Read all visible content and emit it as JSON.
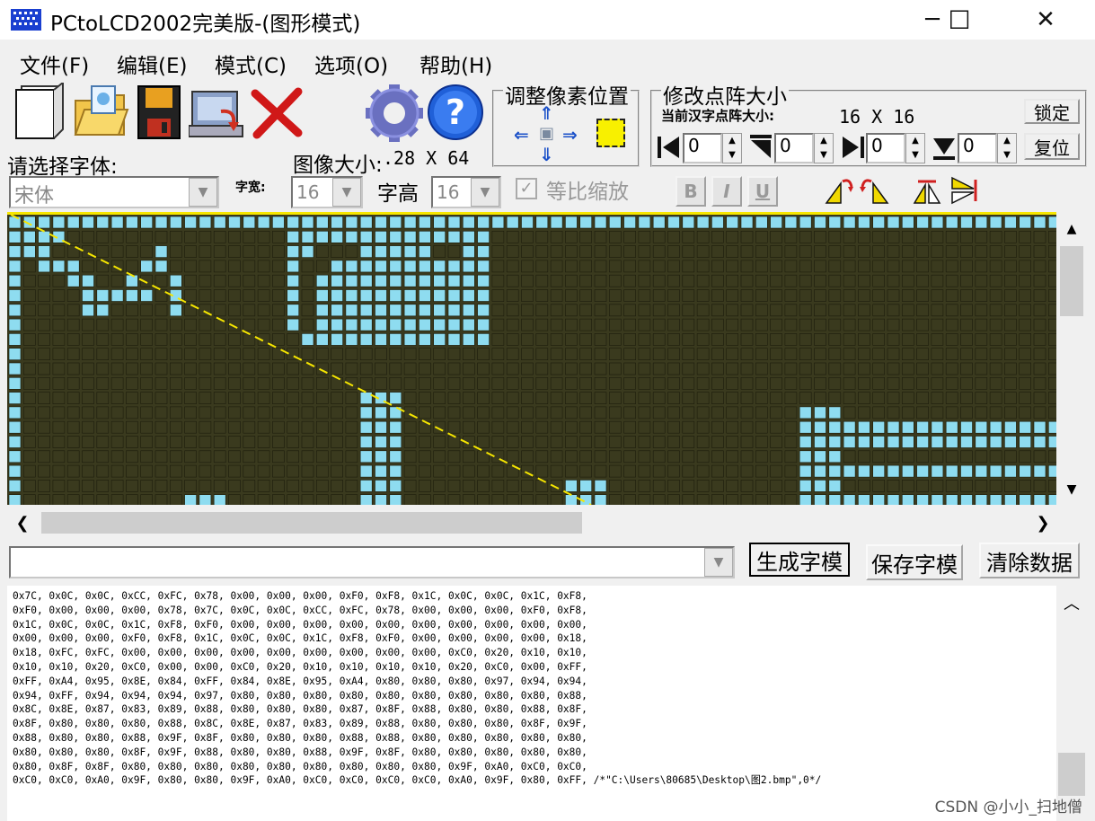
{
  "window": {
    "title": "PCtoLCD2002完美版-(图形模式)",
    "minimize_glyph": "─",
    "maximize_glyph": "☐",
    "close_glyph": "✕"
  },
  "menu": [
    {
      "label": "文件(F)"
    },
    {
      "label": "编辑(E)"
    },
    {
      "label": "模式(C)"
    },
    {
      "label": "选项(O)"
    },
    {
      "label": "帮助(H)"
    }
  ],
  "toolbar": {
    "icons": [
      "new-file-icon",
      "open-folder-icon",
      "save-disk-icon",
      "computer-icon",
      "delete-x-icon",
      "settings-gear-icon",
      "help-question-icon"
    ]
  },
  "pixel_position": {
    "title": "调整像素位置",
    "up_glyph": "⇑",
    "down_glyph": "⇓",
    "left_glyph": "⇐",
    "right_glyph": "⇒",
    "center_glyph": "▣"
  },
  "dot_matrix": {
    "title": "修改点阵大小",
    "current_size_label": "当前汉字点阵大小:",
    "current_size_value": "16 X 16",
    "lock_button": "锁定",
    "reset_button": "复位",
    "spinners": [
      "0",
      "0",
      "0",
      "0"
    ]
  },
  "font": {
    "select_label": "请选择字体:",
    "font_value": "宋体",
    "width_label": "字宽:",
    "width_value": "16",
    "height_label": "字高",
    "height_value": "16",
    "proportional_label": "等比缩放",
    "bold_label": "B",
    "italic_label": "I",
    "underline_label": "U"
  },
  "image": {
    "size_label": "图像大小:",
    "size_value": ".28 X 64"
  },
  "colors": {
    "grid_bg": "#3a3a1e",
    "pixel_on": "#8edcf0",
    "pixel_off": "#3a3a1e",
    "guide_line": "#f6e600"
  },
  "actions": {
    "generate_button": "生成字模",
    "save_button": "保存字模",
    "clear_button": "清除数据"
  },
  "code_output": {
    "lines": [
      "0x7C, 0x0C, 0x0C, 0xCC, 0xFC, 0x78, 0x00, 0x00, 0x00, 0xF0, 0xF8, 0x1C, 0x0C, 0x0C, 0x1C, 0xF8,",
      "0xF0, 0x00, 0x00, 0x00, 0x78, 0x7C, 0x0C, 0x0C, 0xCC, 0xFC, 0x78, 0x00, 0x00, 0x00, 0xF0, 0xF8,",
      "0x1C, 0x0C, 0x0C, 0x1C, 0xF8, 0xF0, 0x00, 0x00, 0x00, 0x00, 0x00, 0x00, 0x00, 0x00, 0x00, 0x00,",
      "0x00, 0x00, 0x00, 0xF0, 0xF8, 0x1C, 0x0C, 0x0C, 0x1C, 0xF8, 0xF0, 0x00, 0x00, 0x00, 0x00, 0x18,",
      "0x18, 0xFC, 0xFC, 0x00, 0x00, 0x00, 0x00, 0x00, 0x00, 0x00, 0x00, 0x00, 0xC0, 0x20, 0x10, 0x10,",
      "0x10, 0x10, 0x20, 0xC0, 0x00, 0x00, 0xC0, 0x20, 0x10, 0x10, 0x10, 0x10, 0x20, 0xC0, 0x00, 0xFF,",
      "0xFF, 0xA4, 0x95, 0x8E, 0x84, 0xFF, 0x84, 0x8E, 0x95, 0xA4, 0x80, 0x80, 0x80, 0x97, 0x94, 0x94,",
      "0x94, 0xFF, 0x94, 0x94, 0x94, 0x97, 0x80, 0x80, 0x80, 0x80, 0x80, 0x80, 0x80, 0x80, 0x80, 0x88,",
      "0x8C, 0x8E, 0x87, 0x83, 0x89, 0x88, 0x80, 0x80, 0x80, 0x87, 0x8F, 0x88, 0x80, 0x80, 0x88, 0x8F,",
      "0x8F, 0x80, 0x80, 0x80, 0x88, 0x8C, 0x8E, 0x87, 0x83, 0x89, 0x88, 0x80, 0x80, 0x80, 0x8F, 0x9F,",
      "0x88, 0x80, 0x80, 0x88, 0x9F, 0x8F, 0x80, 0x80, 0x80, 0x88, 0x88, 0x80, 0x80, 0x80, 0x80, 0x80,",
      "0x80, 0x80, 0x80, 0x8F, 0x9F, 0x88, 0x80, 0x80, 0x88, 0x9F, 0x8F, 0x80, 0x80, 0x80, 0x80, 0x80,",
      "0x80, 0x8F, 0x8F, 0x80, 0x80, 0x80, 0x80, 0x80, 0x80, 0x80, 0x80, 0x80, 0x9F, 0xA0, 0xC0, 0xC0,",
      "0xC0, 0xC0, 0xA0, 0x9F, 0x80, 0x80, 0x9F, 0xA0, 0xC0, 0xC0, 0xC0, 0xC0, 0xA0, 0x9F, 0x80, 0xFF, /*\"C:\\Users\\80685\\Desktop\\图2.bmp\",0*/"
    ]
  },
  "watermark": "CSDN @小小_扫地僧"
}
